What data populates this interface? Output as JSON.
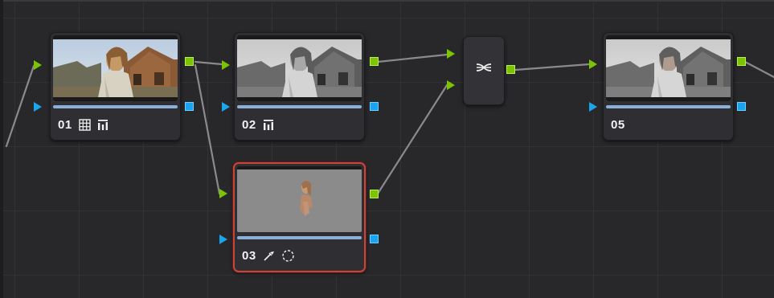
{
  "node_graph": {
    "nodes": [
      {
        "id": "01",
        "label": "01",
        "tools": [
          "grid-icon",
          "levels-icon"
        ],
        "thumbnail": "color",
        "selected": false
      },
      {
        "id": "02",
        "label": "02",
        "tools": [
          "levels-icon"
        ],
        "thumbnail": "grayscale",
        "selected": false
      },
      {
        "id": "03",
        "label": "03",
        "tools": [
          "qualifier-eyedropper-icon",
          "window-circle-icon"
        ],
        "thumbnail": "key-matte",
        "selected": true
      },
      {
        "id": "05",
        "label": "05",
        "tools": [],
        "thumbnail": "grayscale",
        "selected": false
      }
    ],
    "mixer": {
      "icon": "layer-mixer-icon"
    }
  },
  "colors": {
    "canvas_background": "#28282b",
    "grid_line": "#323235",
    "node_background": "#2f2f33",
    "selected_outline": "#c8453a",
    "rgb_port_green": "#7dc400",
    "alpha_port_blue": "#18a4f0",
    "wire": "#8a8a8e"
  }
}
